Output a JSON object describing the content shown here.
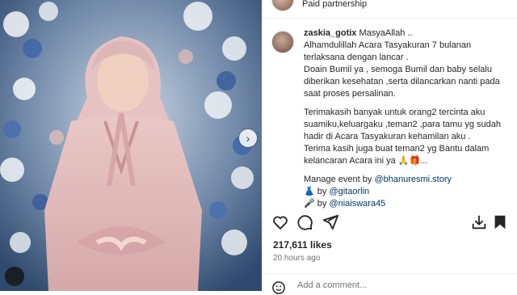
{
  "post": {
    "sponsor_label": "Paid partnership"
  },
  "caption": {
    "username": "zaskia_gotix",
    "first_line": " MasyaAllah ..",
    "lines_1": [
      "Alhamdulillah Acara Tasyakuran 7 bulanan",
      "terlaksana dengan lancar ."
    ],
    "lines_2": [
      "Doain Bumil ya , semoga Bumil dan baby selalu",
      "diberikan kesehatan ,serta dilancarkan nanti pada",
      "saat proses persalinan."
    ],
    "lines_3": [
      "Terimakasih banyak untuk orang2 tercinta aku",
      "suamiku,keluargaku ,teman2 ,para tamu yg sudah",
      "hadir di Acara Tasyakuran kehamilan aku .",
      "Terima kasih juga buat teman2 yg Bantu dalam",
      "kelancaran Acara ini ya 🙏🎁..."
    ],
    "credits": {
      "manage_prefix": "Manage event by ",
      "manage_mention": "@bhanuresmi.story",
      "dress_prefix": "👗 by ",
      "dress_mention": "@gitaorlin",
      "mc_prefix": "🎤 by ",
      "mc_mention": "@niaiswara45"
    }
  },
  "stats": {
    "likes": "217,611 likes",
    "time_ago": "20 hours ago"
  },
  "comment_box": {
    "placeholder": "Add a comment..."
  },
  "icons": {
    "like": "heart-icon",
    "comment": "comment-icon",
    "share": "paper-plane-icon",
    "save": "bookmark-icon",
    "download": "download-icon",
    "next": "chevron-right-icon",
    "emoji": "smiley-icon"
  }
}
